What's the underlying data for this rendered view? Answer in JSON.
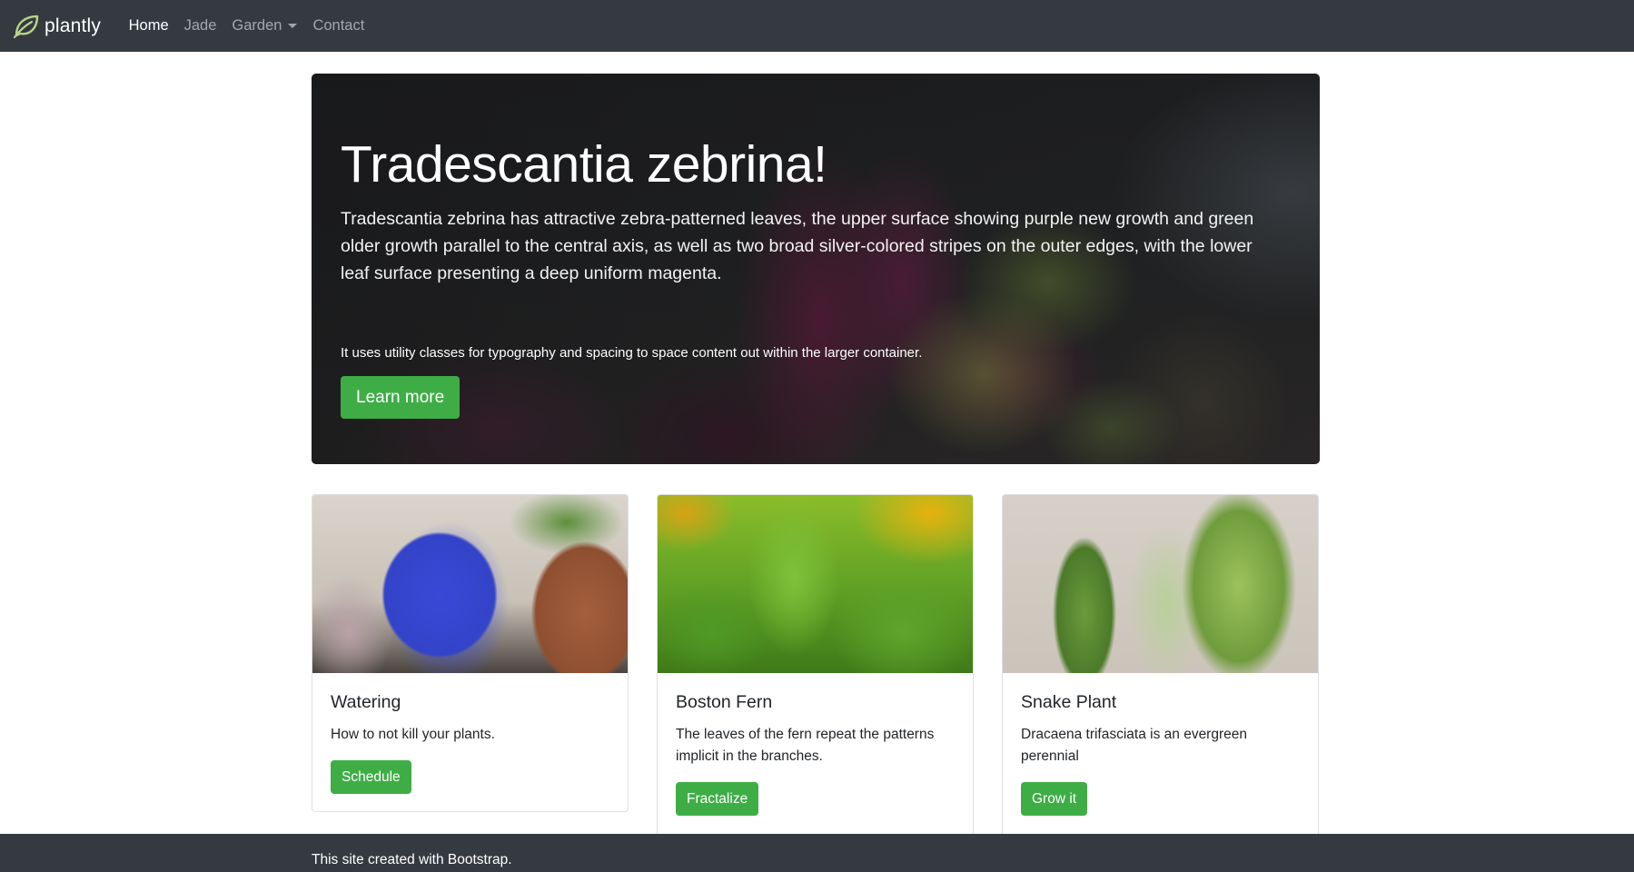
{
  "navbar": {
    "brand": "plantly",
    "links": [
      {
        "label": "Home",
        "active": true
      },
      {
        "label": "Jade",
        "active": false
      },
      {
        "label": "Garden",
        "active": false,
        "dropdown": true
      },
      {
        "label": "Contact",
        "active": false
      }
    ]
  },
  "hero": {
    "title": "Tradescantia zebrina!",
    "lead": "Tradescantia zebrina has attractive zebra-patterned leaves, the upper surface showing purple new growth and green older growth parallel to the central axis, as well as two broad silver-colored stripes on the outer edges, with the lower leaf surface presenting a deep uniform magenta.",
    "note": "It uses utility classes for typography and spacing to space content out within the larger container.",
    "button": "Learn more"
  },
  "cards": [
    {
      "title": "Watering",
      "text": "How to not kill your plants.",
      "button": "Schedule"
    },
    {
      "title": "Boston Fern",
      "text": "The leaves of the fern repeat the patterns implicit in the branches.",
      "button": "Fractalize"
    },
    {
      "title": "Snake Plant",
      "text": "Dracaena trifasciata is an evergreen perennial",
      "button": "Grow it"
    }
  ],
  "footer": {
    "text": "This site created with Bootstrap."
  },
  "colors": {
    "navbar_bg": "#343a40",
    "accent_green": "#3fad46",
    "brand_leaf": "#b9d48a"
  }
}
